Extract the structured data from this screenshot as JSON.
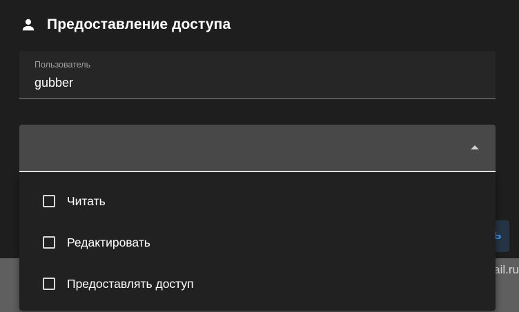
{
  "dialog": {
    "title": "Предоставление доступа",
    "title_icon": "person-icon",
    "user_field": {
      "label": "Пользователь",
      "value": "gubber"
    },
    "permissions_select": {
      "selected_value": "",
      "expanded": true
    },
    "edge_button_fragment": "ь"
  },
  "permissions_menu": {
    "items": [
      {
        "label": "Читать",
        "checked": false
      },
      {
        "label": "Редактировать",
        "checked": false
      },
      {
        "label": "Предоставлять доступ",
        "checked": false
      }
    ]
  },
  "background": {
    "visible_text_fragment": "ail.ru"
  },
  "colors": {
    "dialog_background": "#1e1e1e",
    "select_background": "#484848",
    "menu_background": "#212121",
    "accent_blue": "#3f8fe5"
  }
}
